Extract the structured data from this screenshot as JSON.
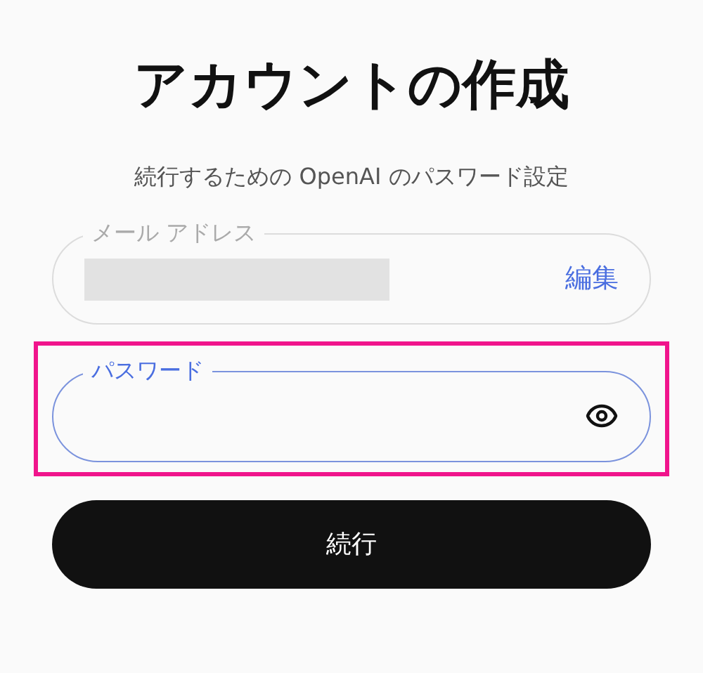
{
  "title": "アカウントの作成",
  "subtitle": "続行するための OpenAI のパスワード設定",
  "email_field": {
    "label": "メール アドレス",
    "redacted": true,
    "action": "編集"
  },
  "password_field": {
    "label": "パスワード",
    "focused": true,
    "highlighted": true
  },
  "continue_button": "続行"
}
